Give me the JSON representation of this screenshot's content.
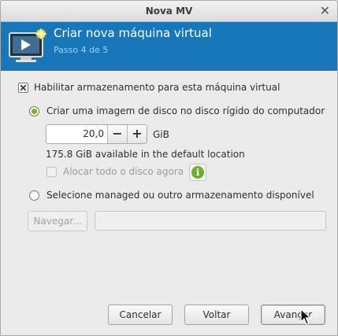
{
  "window": {
    "title": "Nova MV"
  },
  "header": {
    "title": "Criar nova máquina virtual",
    "step": "Passo 4 de 5"
  },
  "storage": {
    "enable_label": "Habilitar armazenamento para esta máquina virtual",
    "enable_checked": true,
    "create_option_label": "Criar uma imagem de disco no disco rígido do computador",
    "size_value": "20,0",
    "size_unit": "GiB",
    "available_text": "175.8 GiB available in the default location",
    "allocate_label": "Alocar todo o disco agora",
    "managed_option_label": "Selecione managed ou outro armazenamento disponível",
    "browse_label": "Navegar...",
    "path_value": ""
  },
  "footer": {
    "cancel_label": "Cancelar",
    "back_label": "Voltar",
    "forward_label": "Avançar"
  },
  "icons": {
    "close": "close-icon",
    "logo": "virtual-machine-icon",
    "info": "info-icon",
    "cursor": "mouse-pointer-icon"
  },
  "colors": {
    "banner": "#1877b9",
    "step_text": "#9fd3f5",
    "radio_accent": "#7bb13a",
    "info_icon": "#6fae2b"
  }
}
